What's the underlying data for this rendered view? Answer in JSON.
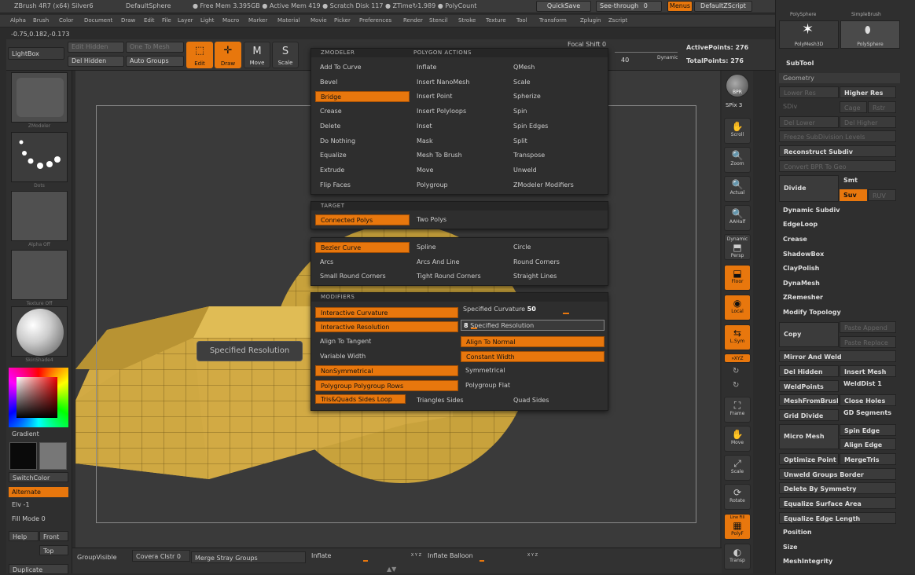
{
  "titlebar": {
    "title": "ZBrush 4R7 (x64) Silver6",
    "doc": "DefaultSphere",
    "free_mem": "● Free Mem 3.395GB ● Active Mem 419 ● Scratch Disk 117 ● ZTime↻1.989 ● PolyCount",
    "quicksave": "QuickSave",
    "seethrough": "See-through",
    "seethrough_val": "0",
    "menus": "Menus",
    "defaultzscript": "DefaultZScript"
  },
  "menubar": [
    "Alpha",
    "Brush",
    "Color",
    "Document",
    "Draw",
    "Edit",
    "File",
    "Layer",
    "Light",
    "Macro",
    "Marker",
    "Material",
    "Movie",
    "Picker",
    "Preferences",
    "Render",
    "Stencil",
    "Stroke",
    "Texture",
    "Tool",
    "Transform",
    "Zplugin",
    "Zscript"
  ],
  "coords": "-0.75,0.182,-0.173",
  "topshelf": {
    "lightbox": "LightBox",
    "edit_hidden": "Edit Hidden",
    "del_hidden": "Del Hidden",
    "one_to_mesh": "One To Mesh",
    "auto_groups": "Auto Groups",
    "edit": "Edit",
    "draw": "Draw",
    "move": "Move",
    "scale": "Scale",
    "focal_shift": "Focal Shift",
    "focal_val": "0",
    "dynamic": "Dynamic",
    "draw_size_val": "40",
    "active_points": "ActivePoints: 276",
    "total_points": "TotalPoints: 276"
  },
  "leftpanel": {
    "thumb1": "ZModeler",
    "thumb2": "Dots",
    "thumb3": "Alpha Off",
    "thumb4": "Texture Off",
    "thumb5": "SkinShade4",
    "gradient": "Gradient",
    "switchcolor": "SwitchColor",
    "alternate": "Alternate",
    "elv": "Elv -1",
    "fill_mode": "Fill Mode 0",
    "help": "Help",
    "front": "Front",
    "top": "Top",
    "duplicate": "Duplicate"
  },
  "tooltip": "Specified Resolution",
  "popup": {
    "zmodeler_hdr": "ZMODELER",
    "polygon_actions_hdr": "POLYGON ACTIONS",
    "actions": [
      [
        "Add To Curve",
        "Inflate",
        "QMesh"
      ],
      [
        "Bevel",
        "Insert NanoMesh",
        "Scale"
      ],
      [
        "Bridge",
        "Insert Point",
        "Spherize"
      ],
      [
        "Crease",
        "Insert Polyloops",
        "Spin"
      ],
      [
        "Delete",
        "Inset",
        "Spin Edges"
      ],
      [
        "Do Nothing",
        "Mask",
        "Split"
      ],
      [
        "Equalize",
        "Mesh To Brush",
        "Transpose"
      ],
      [
        "Extrude",
        "Move",
        "Unweld"
      ],
      [
        "Flip Faces",
        "Polygroup",
        "ZModeler Modifiers"
      ]
    ],
    "target_hdr": "TARGET",
    "targets": [
      "Connected Polys",
      "Two Polys"
    ],
    "curves": [
      [
        "Bezier Curve",
        "Spline",
        "Circle"
      ],
      [
        "Arcs",
        "Arcs And Line",
        "Round Corners"
      ],
      [
        "Small Round Corners",
        "Tight Round Corners",
        "Straight Lines"
      ]
    ],
    "modifiers_hdr": "MODIFIERS",
    "interactive_curvature": "Interactive Curvature",
    "specified_curvature": "Specified Curvature",
    "specified_curvature_val": "50",
    "interactive_resolution": "Interactive Resolution",
    "specified_resolution": "Specified Resolution",
    "specified_resolution_val": "8",
    "align_tangent": "Align To Tangent",
    "align_normal": "Align To Normal",
    "variable_width": "Variable Width",
    "constant_width": "Constant Width",
    "nonsymmetrical": "NonSymmetrical",
    "symmetrical": "Symmetrical",
    "pg_rows": "Polygroup Polygroup Rows",
    "pg_flat": "Polygroup Flat",
    "tris_quads": "Tris&Quads Sides Loop",
    "triangles_sides": "Triangles Sides",
    "quad_sides": "Quad Sides"
  },
  "rightshelf": {
    "bpr": "BPR",
    "spix": "SPix 3",
    "scroll": "Scroll",
    "zoom": "Zoom",
    "actual": "Actual",
    "aahalf": "AAHalf",
    "dynamic": "Dynamic",
    "persp": "Persp",
    "floor": "Floor",
    "local": "Local",
    "lsym": "L.Sym",
    "xyz": "»XYZ",
    "frame": "Frame",
    "move": "Move",
    "scale": "Scale",
    "rotate": "Rotate",
    "linefill": "Line Fill",
    "polyf": "PolyF",
    "transp": "Transp"
  },
  "rightpanel": {
    "polysphere": "PolySphere",
    "simplebrush": "SimpleBrush",
    "polymesh3d": "PolyMesh3D",
    "polysphere2": "PolySphere",
    "subtool": "SubTool",
    "geometry": "Geometry",
    "lower_res": "Lower Res",
    "higher_res": "Higher Res",
    "sdiv": "SDiv",
    "cage": "Cage",
    "rstr": "Rstr",
    "del_lower": "Del Lower",
    "del_higher": "Del Higher",
    "freeze_sub": "Freeze SubDivision Levels",
    "reconstruct_subdiv": "Reconstruct Subdiv",
    "convert_bpr": "Convert BPR To Geo",
    "divide": "Divide",
    "smt": "Smt",
    "suv": "Suv",
    "ruv": "RUV",
    "dynamic_subdiv": "Dynamic Subdiv",
    "edgeloop": "EdgeLoop",
    "crease": "Crease",
    "shadowbox": "ShadowBox",
    "claypolish": "ClayPolish",
    "dynamesh": "DynaMesh",
    "zremesher": "ZRemesher",
    "modify_topology": "Modify Topology",
    "copy": "Copy",
    "paste_append": "Paste Append",
    "paste_replace": "Paste Replace",
    "mirror_weld": "Mirror And Weld",
    "del_hidden": "Del Hidden",
    "insert_mesh": "Insert Mesh",
    "weldpoints": "WeldPoints",
    "welddist": "WeldDist 1",
    "meshfrombrush": "MeshFromBrush",
    "close_holes": "Close Holes",
    "grid_divide": "Grid Divide",
    "gd_segments": "GD Segments",
    "micro_mesh": "Micro Mesh",
    "spin_edge": "Spin Edge",
    "align_edge": "Align Edge",
    "optimize_point": "Optimize Point",
    "mergetris": "MergeTris",
    "unweld_groups": "Unweld Groups Border",
    "delete_symmetry": "Delete By Symmetry",
    "equalize_surface": "Equalize Surface Area",
    "equalize_edge": "Equalize Edge Length",
    "position": "Position",
    "size": "Size",
    "meshintegrity": "MeshIntegrity"
  },
  "bottombar": {
    "groupvisible": "GroupVisible",
    "coverage": "Covera Clstr",
    "coverage_val": "0",
    "merge_stray": "Merge Stray Groups",
    "inflate": "Inflate",
    "inflate_balloon": "Inflate Balloon",
    "xyz1": "X Y Z",
    "xyz2": "X Y Z"
  },
  "colors": {
    "accent": "#e8770d",
    "panel": "#2f2f2f",
    "mesh": "#c8a23c"
  }
}
